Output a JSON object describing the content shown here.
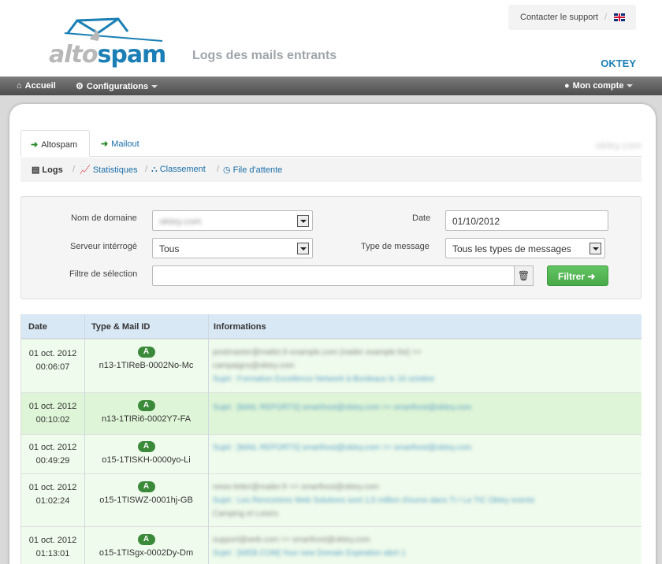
{
  "header": {
    "logo_part1": "alto",
    "logo_part2": "spam",
    "page_title": "Logs des mails entrants",
    "support_link": "Contacter le support",
    "separator": "/",
    "company": "OKTEY"
  },
  "navbar": {
    "home": "Accueil",
    "configurations": "Configurations",
    "account": "Mon compte"
  },
  "tabs": [
    {
      "label": "Altospam",
      "active": true
    },
    {
      "label": "Mailout",
      "active": false
    }
  ],
  "domain_label_blurred": "oktey.com",
  "subnav": [
    {
      "label": "Logs",
      "icon": "book-icon",
      "active": true
    },
    {
      "label": "Statistiques",
      "icon": "chart-icon",
      "active": false
    },
    {
      "label": "Classement",
      "icon": "hierarchy-icon",
      "active": false
    },
    {
      "label": "File d'attente",
      "icon": "clock-icon",
      "active": false
    }
  ],
  "filter": {
    "domain_label": "Nom de domaine",
    "domain_value": "oktey.com",
    "date_label": "Date",
    "date_value": "01/10/2012",
    "server_label": "Serveur intérrogé",
    "server_value": "Tous",
    "msgtype_label": "Type de message",
    "msgtype_value": "Tous les types de messages",
    "selection_label": "Filtre de sélection",
    "selection_value": "",
    "filter_button": "Filtrer ➜"
  },
  "table": {
    "headers": [
      "Date",
      "Type & Mail ID",
      "Informations"
    ],
    "rows": [
      {
        "date": "01 oct. 2012",
        "time": "00:06:07",
        "type": "A",
        "id": "n13-1TIReB-0002No-Mc",
        "info1": "postmaster@mailer.fr-example.com (mailer example list) >> ",
        "info2": "campaigns@oktey.com",
        "info3": "Sujet : Formation Excellence Network à Bordeaux le 16 octobre"
      },
      {
        "date": "01 oct. 2012",
        "time": "00:10:02",
        "type": "A",
        "id": "n13-1TIRi6-0002Y7-FA",
        "info1": "",
        "info2": "Sujet : [MAIL REPORTS] smarthost@oktey.com >> smarthost@oktey.com",
        "info3": ""
      },
      {
        "date": "01 oct. 2012",
        "time": "00:49:29",
        "type": "A",
        "id": "o15-1TISKH-0000yo-Li",
        "info1": "",
        "info2": "Sujet : [MAIL REPORTS] smarthost@oktey.com >> smarthost@oktey.com",
        "info3": ""
      },
      {
        "date": "01 oct. 2012",
        "time": "01:02:24",
        "type": "A",
        "id": "o15-1TISWZ-0001hj-GB",
        "info1": "news-letter@mailer.fr >> smarthost@oktey.com",
        "info2": "Sujet : Les Rencontres Web Solutions sont 1,5 million d'euros dans TI / Le TIC Oktey events",
        "info3": "Camping et Loisirs"
      },
      {
        "date": "01 oct. 2012",
        "time": "01:13:01",
        "type": "A",
        "id": "o15-1TISgx-0002Dy-Dm",
        "info1": "support@web.com >> smarthost@oktey.com",
        "info2": "Sujet : [WEB.COM] Your new Domain Expiration alert 1",
        "info3": ""
      }
    ]
  }
}
